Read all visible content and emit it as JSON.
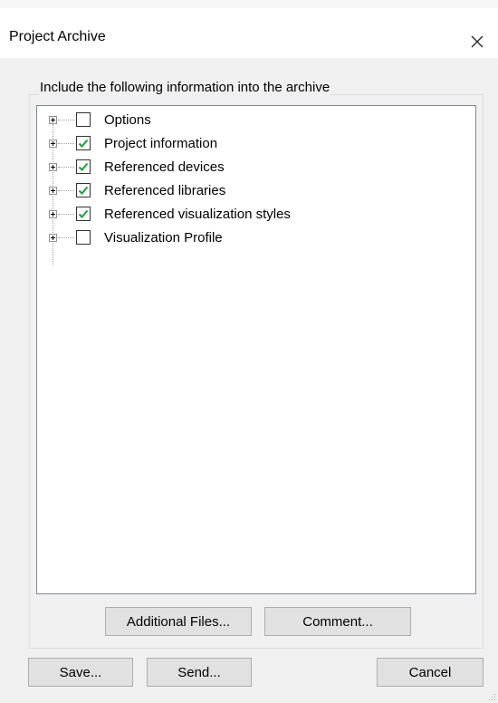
{
  "window": {
    "title": "Project Archive",
    "close_icon": "close-icon"
  },
  "group": {
    "legend": "Include the following information into the archive"
  },
  "tree": {
    "items": [
      {
        "label": "Options",
        "checked": false
      },
      {
        "label": "Project information",
        "checked": true
      },
      {
        "label": "Referenced devices",
        "checked": true
      },
      {
        "label": "Referenced libraries",
        "checked": true
      },
      {
        "label": "Referenced visualization styles",
        "checked": true
      },
      {
        "label": "Visualization Profile",
        "checked": false
      }
    ]
  },
  "buttons": {
    "additional_files": "Additional Files...",
    "comment": "Comment...",
    "save": "Save...",
    "send": "Send...",
    "cancel": "Cancel"
  },
  "colors": {
    "checkmark": "#1a9d3c",
    "dialog_bg": "#f0f0f0",
    "button_bg": "#e1e1e1"
  }
}
